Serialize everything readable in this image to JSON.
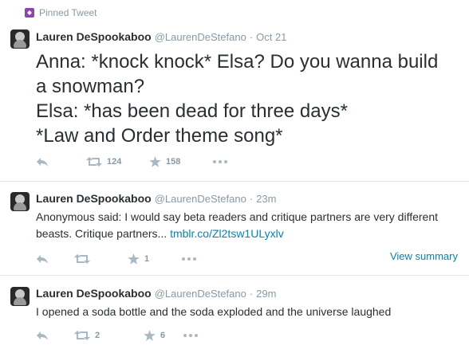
{
  "pinned_label": "Pinned Tweet",
  "tweets": [
    {
      "name": "Lauren DeSpookaboo",
      "handle": "@LaurenDeStefano",
      "separator": "·",
      "time": "Oct 21",
      "text": "Anna: *knock knock* Elsa? Do you wanna build a snowman?\nElsa: *has been dead for three days*\n*Law and Order theme song*",
      "retweets": "124",
      "favorites": "158"
    },
    {
      "name": "Lauren DeSpookaboo",
      "handle": "@LaurenDeStefano",
      "separator": "·",
      "time": "23m",
      "text": "Anonymous said: I would say beta readers and critique partners are very different beasts. Critique partners...",
      "link": "tmblr.co/Zl2tsw1ULyxlv",
      "retweets": "",
      "favorites": "1",
      "view_summary": "View summary"
    },
    {
      "name": "Lauren DeSpookaboo",
      "handle": "@LaurenDeStefano",
      "separator": "·",
      "time": "29m",
      "text": "I opened a soda bottle and the soda exploded and the universe laughed",
      "retweets": "2",
      "favorites": "6"
    }
  ],
  "icons": {
    "pin": "pin-icon",
    "reply": "reply-icon",
    "retweet": "retweet-icon",
    "favorite": "star-icon",
    "more": "more-icon"
  },
  "colors": {
    "text": "#292f33",
    "muted": "#8899a6",
    "action": "#aab8c2",
    "link": "#0084b4",
    "pin": "#8e44ad",
    "divider": "#e1e8ed"
  }
}
